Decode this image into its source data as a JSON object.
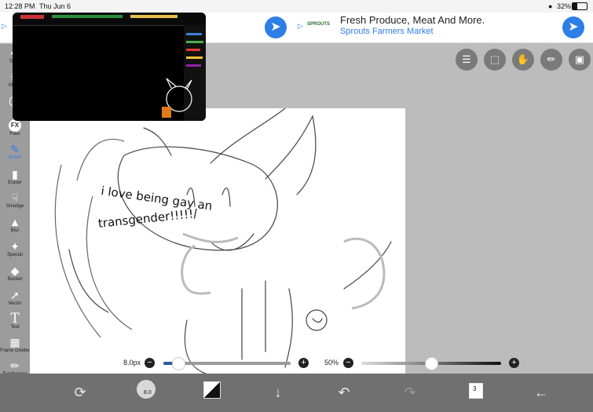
{
  "status": {
    "time": "12:28 PM",
    "date": "Thu Jun 6",
    "battery": "32%"
  },
  "ad": {
    "headline": "Fresh Produce, Meat And More.",
    "advertiser": "Sprouts Farmers Market",
    "logo_text": "SPROUTS",
    "accent": "#2d7ee6"
  },
  "drawing": {
    "caption_line1": "i love being gay an",
    "caption_line2": "transgender!!!!!/"
  },
  "toolbar": {
    "tools": [
      {
        "label": "Trans",
        "icon": "move-icon"
      },
      {
        "label": "Magic",
        "icon": "magic-wand-icon"
      },
      {
        "label": "La",
        "icon": "lasso-icon"
      },
      {
        "label": "Filter",
        "icon": "fx-icon"
      },
      {
        "label": "Brush",
        "icon": "brush-icon"
      },
      {
        "label": "Eraser",
        "icon": "eraser-icon"
      },
      {
        "label": "Smudge",
        "icon": "smudge-icon"
      },
      {
        "label": "Blur",
        "icon": "blur-drop-icon"
      },
      {
        "label": "Special",
        "icon": "special-wand-icon"
      },
      {
        "label": "Bucket",
        "icon": "bucket-icon"
      },
      {
        "label": "Vector",
        "icon": "vector-arrow-icon"
      },
      {
        "label": "Text",
        "icon": "text-icon"
      },
      {
        "label": "Frame Divider",
        "icon": "frame-divider-icon"
      },
      {
        "label": "Eyedropper",
        "icon": "eyedropper-icon"
      }
    ],
    "fx_label": "FX",
    "text_tool_glyph": "T"
  },
  "sliders": {
    "brush_size_label": "8.0px",
    "brush_size_fraction": 0.12,
    "opacity_label": "50%",
    "opacity_fraction": 0.5
  },
  "bottombar": {
    "brush_size_badge": "8.0",
    "layers_count": "3"
  }
}
